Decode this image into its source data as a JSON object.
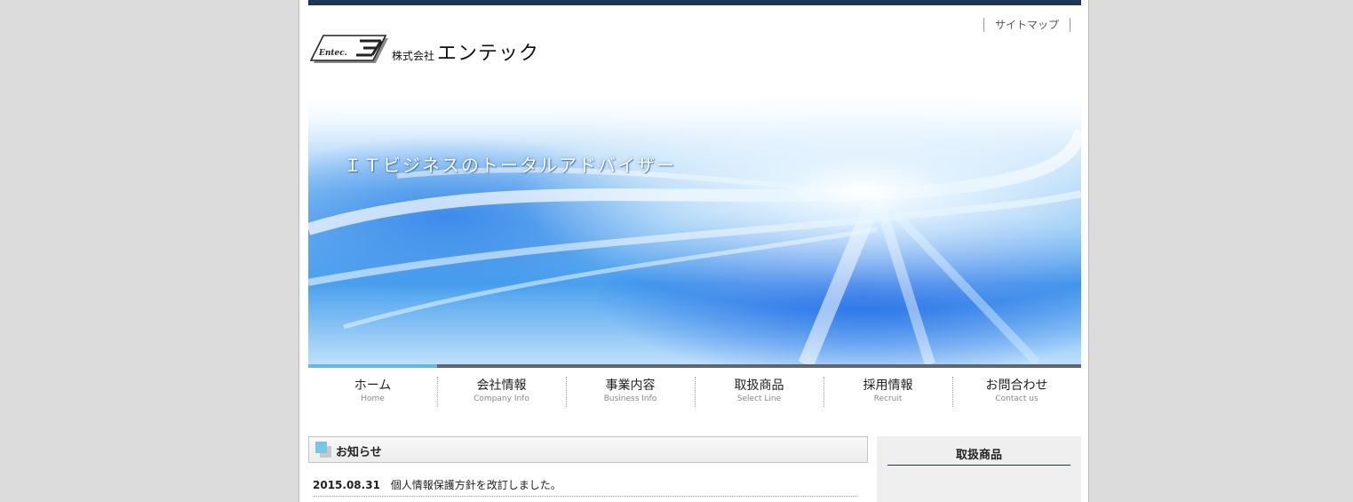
{
  "header": {
    "sitemap_label": "サイトマップ",
    "company_prefix": "株式会社",
    "company_name": "エンテック",
    "logo_text": "Entec."
  },
  "hero": {
    "tagline": "ＩＴビジネスのトータルアドバイザー"
  },
  "nav": {
    "items": [
      {
        "label": "ホーム",
        "sub": "Home",
        "active": true
      },
      {
        "label": "会社情報",
        "sub": "Company Info"
      },
      {
        "label": "事業内容",
        "sub": "Business Info"
      },
      {
        "label": "取扱商品",
        "sub": "Select Line"
      },
      {
        "label": "採用情報",
        "sub": "Recruit"
      },
      {
        "label": "お問合わせ",
        "sub": "Contact us"
      }
    ]
  },
  "news": {
    "title": "お知らせ",
    "items": [
      {
        "date": "2015.08.31",
        "text": "個人情報保護方針を改訂しました。"
      }
    ]
  },
  "sidebar": {
    "title": "取扱商品"
  },
  "colors": {
    "top_bar": "#1f3658",
    "nav_active": "#6ab8d8",
    "nav_border": "#5f6670",
    "news_icon": "#78c6e8"
  }
}
